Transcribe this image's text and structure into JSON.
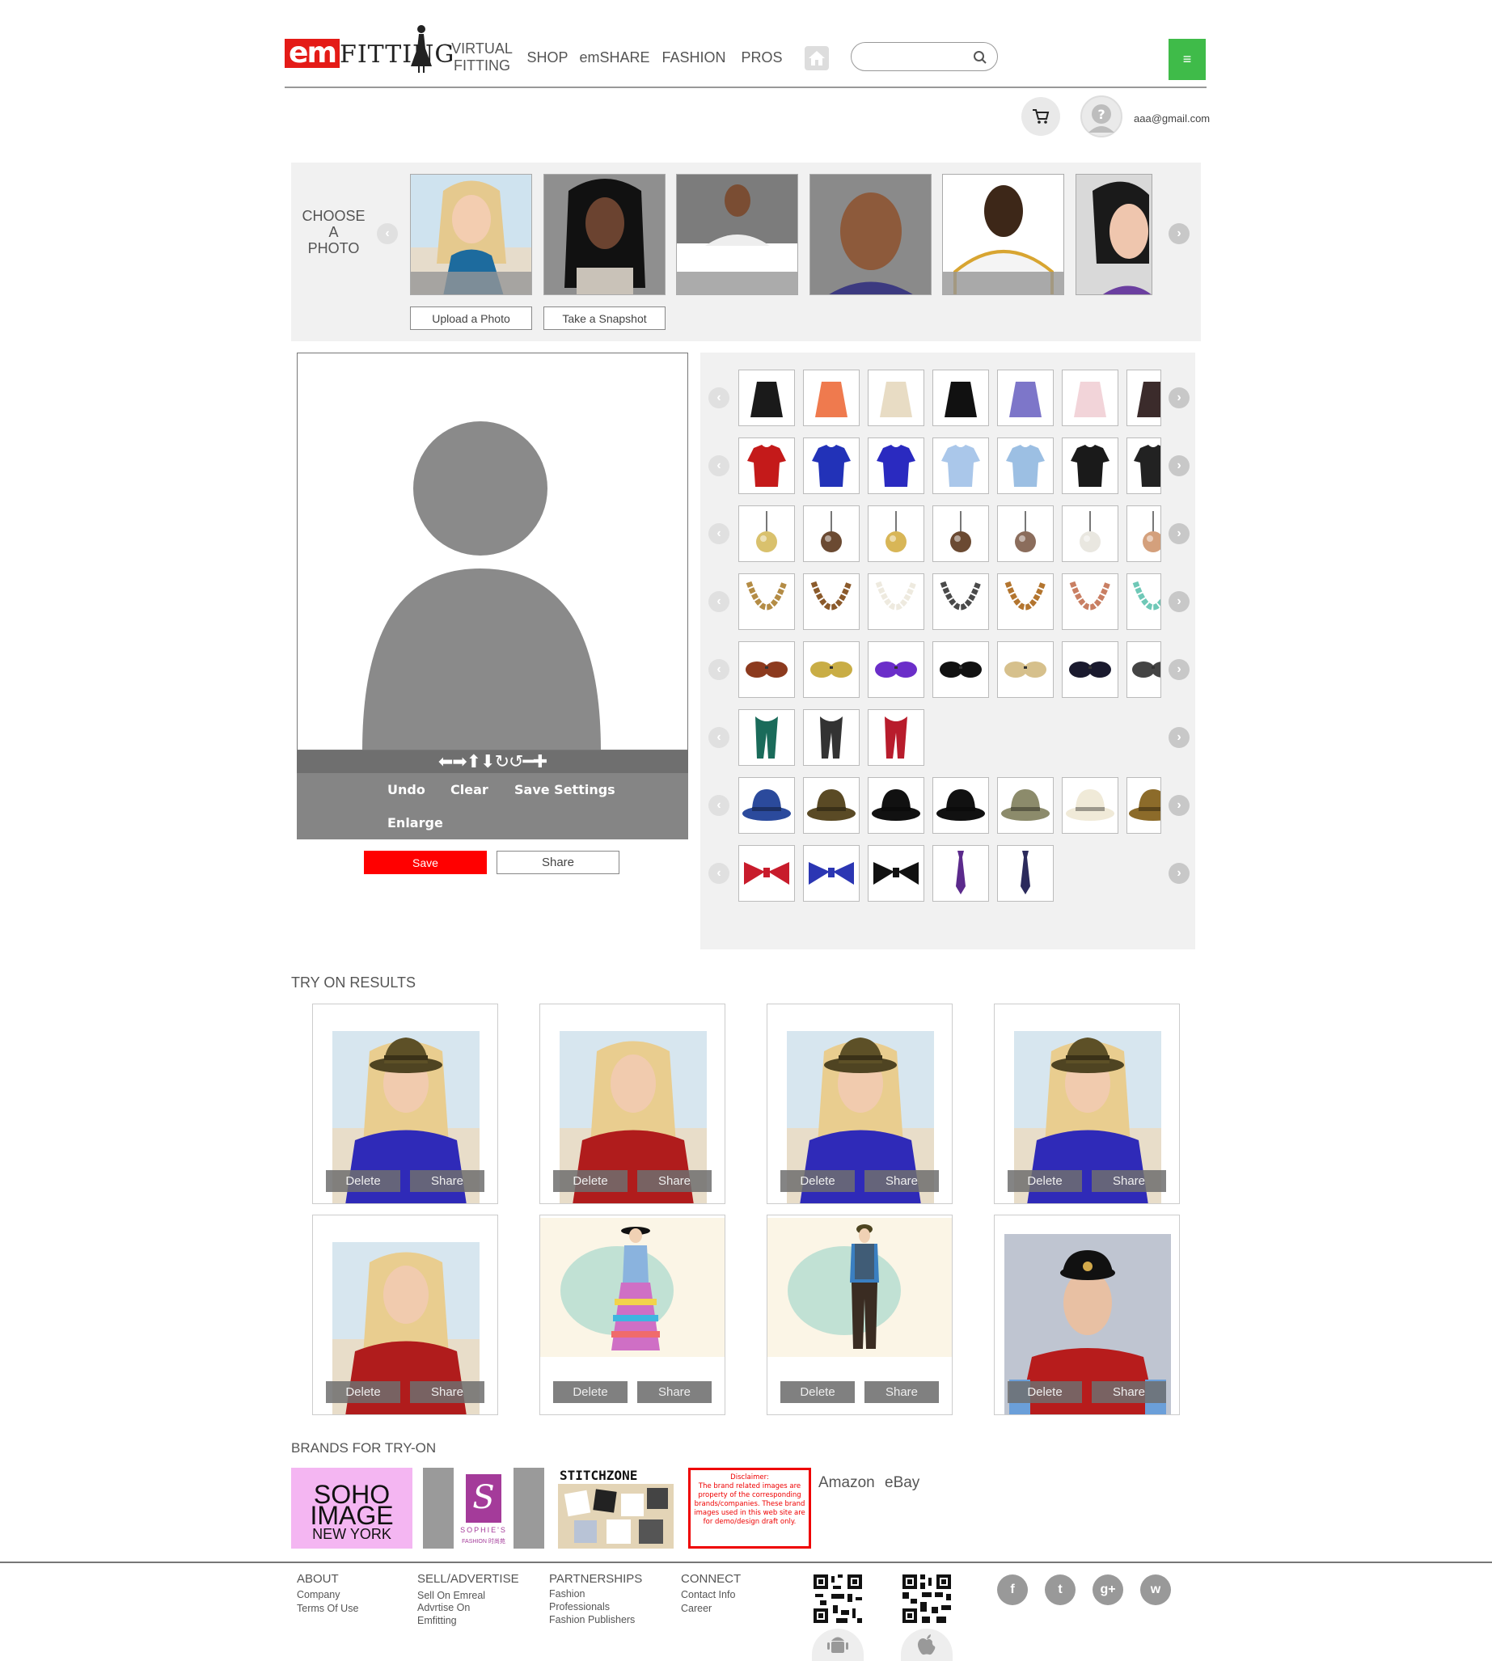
{
  "header": {
    "logo_em": "em",
    "logo_fitting": "FITTING",
    "nav": {
      "virtual_fitting": "VIRTUAL FITTING",
      "shop": "SHOP",
      "emshare": "emSHARE",
      "fashion": "FASHION",
      "pros": "PROS"
    },
    "search": {
      "value": "",
      "placeholder": ""
    },
    "menu_icon": "≡",
    "user_email": "aaa@gmail.com",
    "icons": [
      "home-icon",
      "search-icon",
      "menu-icon",
      "cart-icon",
      "avatar-icon"
    ]
  },
  "choose_photo": {
    "label_line1": "CHOOSE",
    "label_line2": "A",
    "label_line3": "PHOTO",
    "upload_label": "Upload a Photo",
    "snapshot_label": "Take a Snapshot",
    "photo_count": 6
  },
  "editor": {
    "controls_glyphs": "⬅➡⬆⬇↻↺━✚",
    "undo": "Undo",
    "clear": "Clear",
    "save_settings": "Save Settings",
    "enlarge": "Enlarge",
    "save": "Save",
    "share": "Share"
  },
  "catalog": {
    "rows": [
      {
        "category": "skirts",
        "count": 7
      },
      {
        "category": "tops",
        "count": 7
      },
      {
        "category": "earrings",
        "count": 7
      },
      {
        "category": "necklaces",
        "count": 7
      },
      {
        "category": "sunglasses",
        "count": 7
      },
      {
        "category": "scarves",
        "count": 3
      },
      {
        "category": "hats",
        "count": 7
      },
      {
        "category": "ties",
        "count": 5
      }
    ]
  },
  "results": {
    "title": "TRY ON RESULTS",
    "delete_label": "Delete",
    "share_label": "Share",
    "count": 8
  },
  "brands": {
    "title": "BRANDS FOR TRY-ON",
    "soho_line1": "SOHO",
    "soho_line2": "IMAGE",
    "soho_line3": "NEW YORK",
    "sophies_letter": "S",
    "sophies_name": "SOPHIE'S",
    "sophies_sub": "FASHION 时尚苑",
    "stitchzone": "STITCHZONE",
    "disclaimer_title": "Disclaimer:",
    "disclaimer_body": "The brand related images are property of the corresponding brands/companies. These brand images used in this web site are for demo/design draft only.",
    "amazon": "Amazon",
    "ebay": "eBay"
  },
  "footer": {
    "about": {
      "head": "ABOUT",
      "links": [
        "Company",
        "Terms Of Use"
      ]
    },
    "sell": {
      "head": "SELL/ADVERTISE",
      "links": [
        "Sell On Emreal",
        "Advrtise On",
        "Emfitting"
      ]
    },
    "partnerships": {
      "head": "PARTNERSHIPS",
      "links": [
        "Fashion",
        "Professionals",
        "Fashion Publishers"
      ]
    },
    "connect": {
      "head": "CONNECT",
      "links": [
        "Contact Info",
        "Career"
      ]
    },
    "social": [
      "facebook-icon",
      "twitter-icon",
      "google-plus-icon",
      "wechat-icon"
    ],
    "social_glyphs": [
      "f",
      "t",
      "g+",
      "w"
    ]
  },
  "colors": {
    "brand_red": "#e41b17",
    "menu_green": "#3fbb49",
    "panel_gray": "#f1f1f1",
    "save_red": "#ff0000"
  }
}
